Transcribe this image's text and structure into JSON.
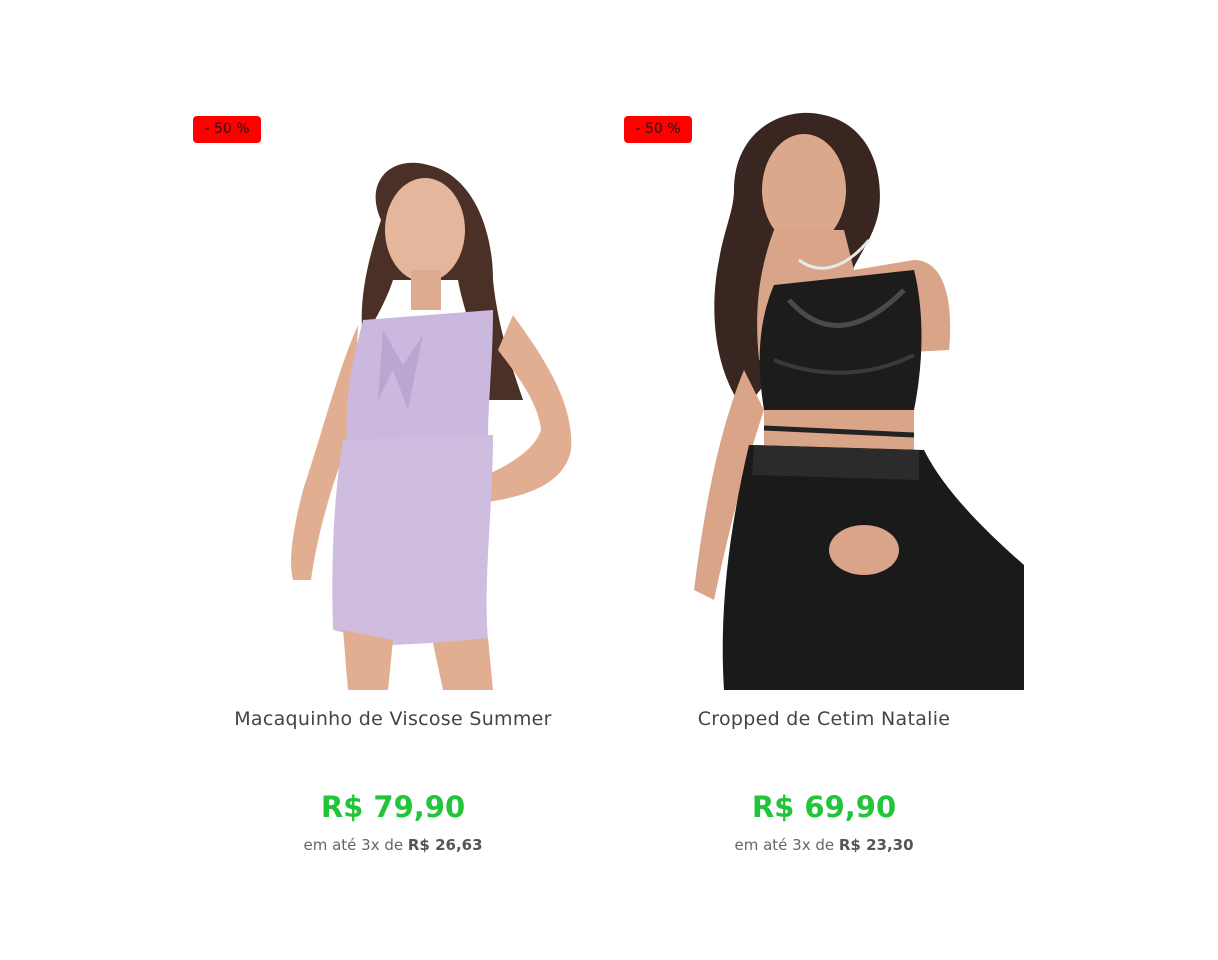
{
  "colors": {
    "badge_bg": "#ff0000",
    "price": "#22c43a",
    "name_text": "#444444"
  },
  "products": [
    {
      "badge": "- 50 %",
      "name": "Macaquinho de Viscose Summer",
      "price": "R$ 79,90",
      "installments_prefix": "em até 3x de",
      "installment_value": "R$ 26,63",
      "image_alt": "woman-in-lilac-romper-photo"
    },
    {
      "badge": "- 50 %",
      "name": "Cropped de Cetim Natalie",
      "price": "R$ 69,90",
      "installments_prefix": "em até 3x de",
      "installment_value": "R$ 23,30",
      "image_alt": "woman-in-black-satin-crop-top-photo"
    }
  ]
}
